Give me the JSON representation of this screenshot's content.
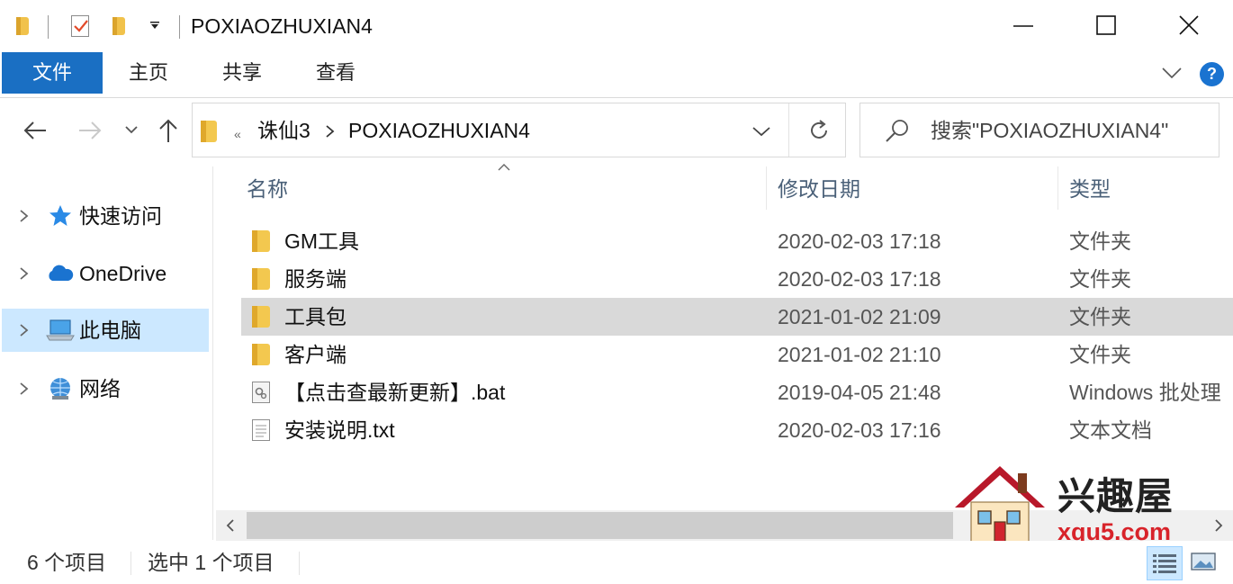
{
  "window": {
    "title": "POXIAOZHUXIAN4"
  },
  "ribbon": {
    "tabs": [
      {
        "label": "文件"
      },
      {
        "label": "主页"
      },
      {
        "label": "共享"
      },
      {
        "label": "查看"
      }
    ],
    "help_label": "?"
  },
  "address": {
    "overflow": "«",
    "crumbs": [
      "诛仙3",
      "POXIAOZHUXIAN4"
    ]
  },
  "search": {
    "placeholder": "搜索\"POXIAOZHUXIAN4\""
  },
  "nav": {
    "items": [
      {
        "label": "快速访问",
        "icon": "star-pin-icon"
      },
      {
        "label": "OneDrive",
        "icon": "cloud-icon"
      },
      {
        "label": "此电脑",
        "icon": "computer-icon",
        "selected": true
      },
      {
        "label": "网络",
        "icon": "network-icon"
      }
    ]
  },
  "columns": {
    "name": "名称",
    "date": "修改日期",
    "type": "类型"
  },
  "files": [
    {
      "name": "GM工具",
      "date": "2020-02-03 17:18",
      "type": "文件夹",
      "icon": "folder-icon"
    },
    {
      "name": "服务端",
      "date": "2020-02-03 17:18",
      "type": "文件夹",
      "icon": "folder-icon"
    },
    {
      "name": "工具包",
      "date": "2021-01-02 21:09",
      "type": "文件夹",
      "icon": "folder-icon",
      "selected": true
    },
    {
      "name": "客户端",
      "date": "2021-01-02 21:10",
      "type": "文件夹",
      "icon": "folder-icon"
    },
    {
      "name": "【点击查最新更新】.bat",
      "date": "2019-04-05 21:48",
      "type": "Windows 批处理",
      "icon": "batch-file-icon"
    },
    {
      "name": "安装说明.txt",
      "date": "2020-02-03 17:16",
      "type": "文本文档",
      "icon": "text-file-icon"
    }
  ],
  "status": {
    "count": "6 个项目",
    "selection": "选中 1 个项目"
  },
  "watermark": {
    "title": "兴趣屋",
    "url": "xqu5.com"
  },
  "colors": {
    "accent": "#1a6fc3",
    "selection": "#cce8ff",
    "row_selected": "#d9d9d9",
    "folder": "#f3c84f"
  }
}
